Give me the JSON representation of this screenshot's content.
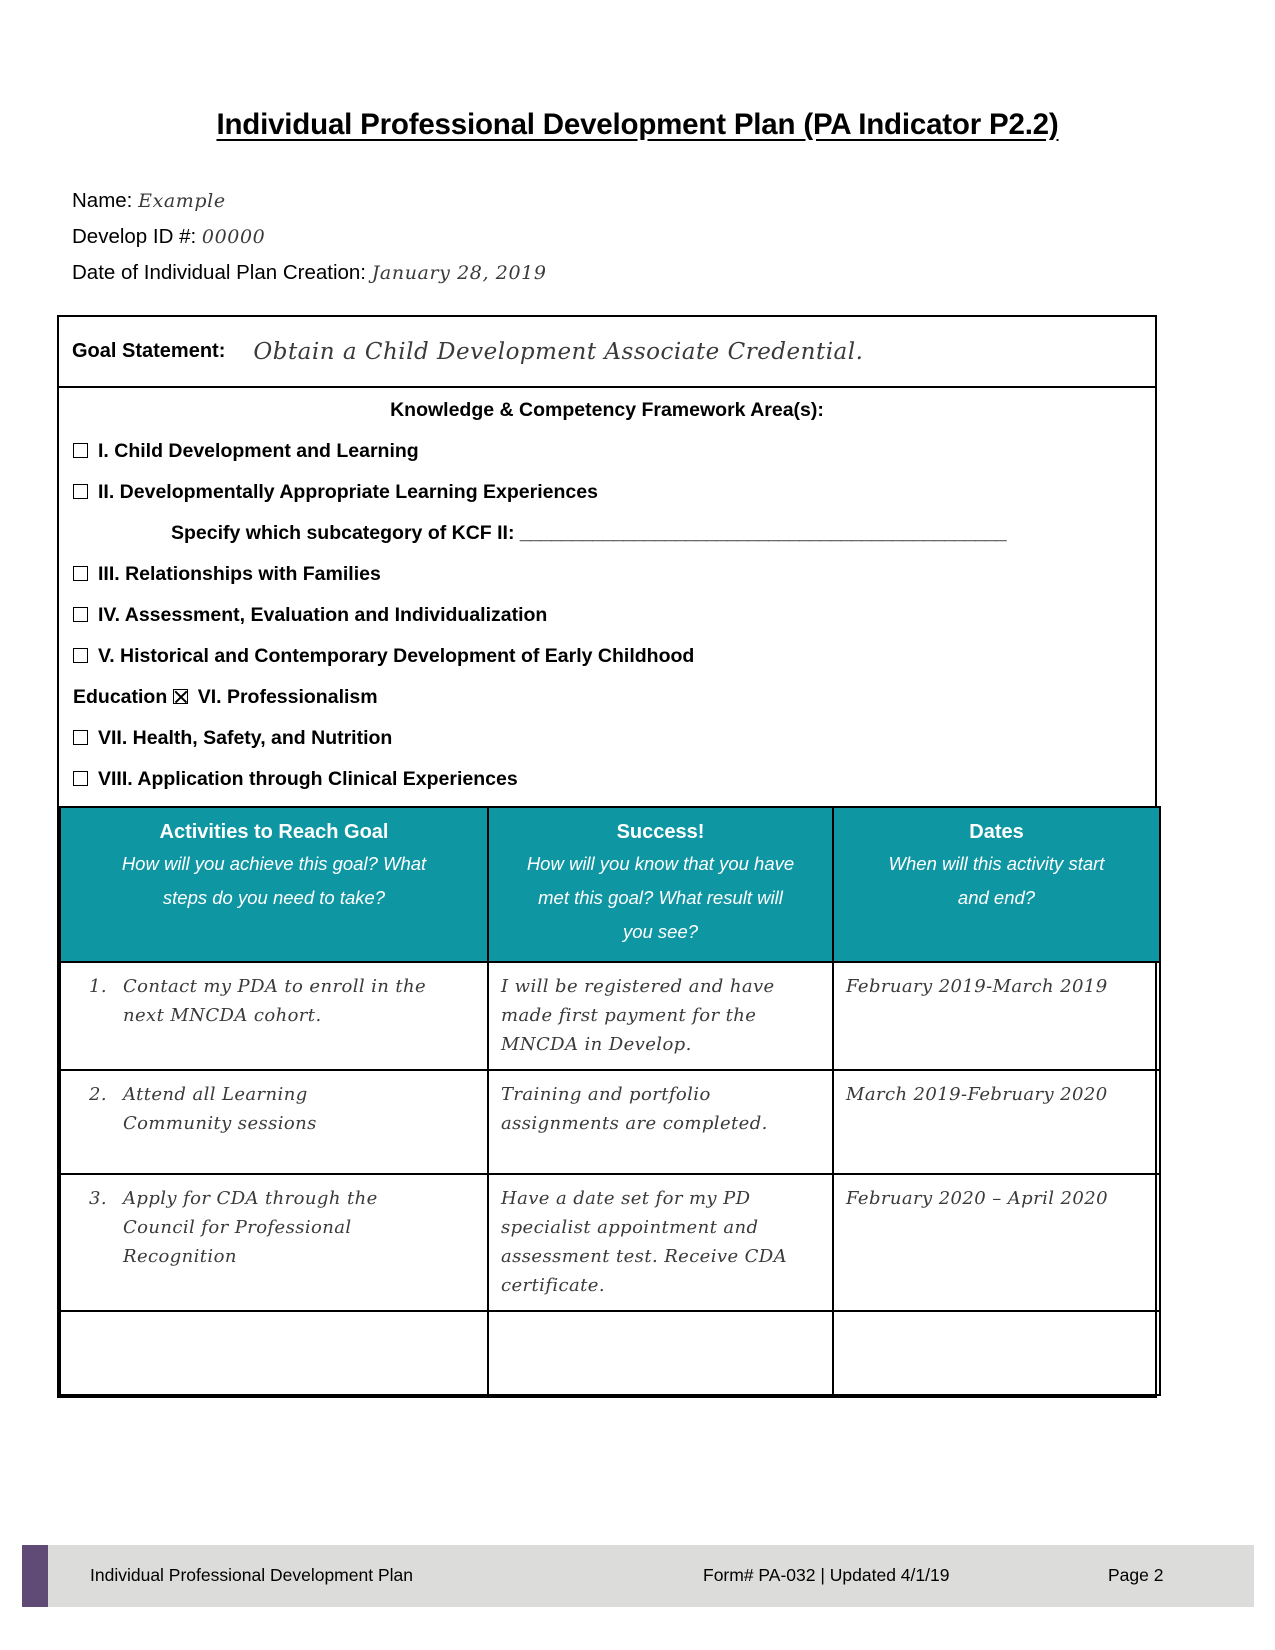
{
  "document": {
    "title_text": "Individual Professional Development Plan (PA Indicator P2.2)"
  },
  "identity": {
    "name_label": "Name:",
    "name_value": "Example",
    "develop_id_label": "Develop ID #:",
    "develop_id_value": "00000",
    "creation_date_label": "Date of Individual Plan Creation:",
    "creation_date_value": "January 28, 2019"
  },
  "goal": {
    "label": "Goal Statement:",
    "value": "Obtain a Child Development Associate Credential."
  },
  "kcf": {
    "heading": "Knowledge & Competency Framework Area(s):",
    "items": [
      {
        "label": "I. Child Development and Learning",
        "checked": false
      },
      {
        "label": "II. Developmentally Appropriate Learning Experiences",
        "checked": false
      },
      {
        "label": "III. Relationships with Families",
        "checked": false
      },
      {
        "label": "IV. Assessment, Evaluation and Individualization",
        "checked": false
      },
      {
        "label": "V. Historical and Contemporary Development of Early Childhood",
        "checked": false
      },
      {
        "label": "VI. Professionalism",
        "checked": true
      },
      {
        "label": "VII. Health, Safety, and Nutrition",
        "checked": false
      },
      {
        "label": "VIII. Application through Clinical Experiences",
        "checked": false
      }
    ],
    "subcategory_label": "Specify which subcategory of KCF II:",
    "subcategory_blank": "_______________________________________________",
    "wrap_prefix": "Education"
  },
  "activities_table": {
    "columns": [
      {
        "title": "Activities to Reach Goal",
        "subtitle_lines": [
          "How will you achieve this goal? What",
          "steps do you need to take?"
        ]
      },
      {
        "title": "Success!",
        "subtitle_lines": [
          "How will you know that you have",
          "met this goal? What result will",
          "you see?"
        ]
      },
      {
        "title": "Dates",
        "subtitle_lines": [
          "When will this activity start",
          "and end?"
        ]
      }
    ],
    "rows": [
      {
        "number": "1.",
        "activity_lines": [
          "Contact my PDA to enroll in the",
          "next MNCDA cohort."
        ],
        "success_lines": [
          "I will be registered and have",
          "made first payment for the",
          "MNCDA in Develop."
        ],
        "dates_lines": [
          "February 2019-March 2019"
        ]
      },
      {
        "number": "2.",
        "activity_lines": [
          "Attend all Learning",
          "Community sessions"
        ],
        "success_lines": [
          "Training and portfolio",
          "assignments are completed."
        ],
        "dates_lines": [
          "March 2019-February 2020"
        ]
      },
      {
        "number": "3.",
        "activity_lines": [
          "Apply for CDA through the",
          "Council for Professional",
          "Recognition"
        ],
        "success_lines": [
          "Have a date set for my PD",
          "specialist appointment and",
          "assessment test. Receive CDA",
          "certificate."
        ],
        "dates_lines": [
          "February 2020 – April 2020"
        ]
      },
      {
        "number": "",
        "activity_lines": [],
        "success_lines": [],
        "dates_lines": []
      }
    ]
  },
  "footer": {
    "left": "Individual Professional Development Plan",
    "center": "Form# PA-032 | Updated 4/1/19",
    "right": "Page 2"
  },
  "colors": {
    "table_header_teal": "#0f96a3",
    "footer_band": "#dcdcda",
    "footer_accent": "#5f4b76",
    "handwriting": "#3a3a3a"
  }
}
